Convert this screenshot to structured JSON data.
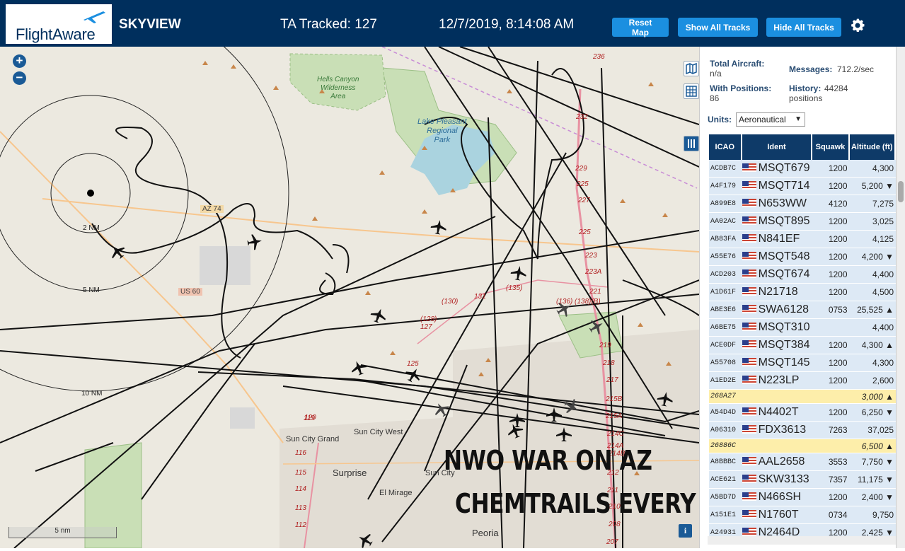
{
  "header": {
    "logo_text": "FlightAware",
    "title": "SKYVIEW",
    "tracked": "TA Tracked: 127",
    "datetime": "12/7/2019, 8:14:08 AM",
    "buttons": {
      "reset": "Reset Map",
      "show": "Show All Tracks",
      "hide": "Hide All Tracks"
    },
    "colors": {
      "bar": "#002f5d",
      "button": "#1b8fe0"
    }
  },
  "map": {
    "zoom_in": "+",
    "zoom_out": "−",
    "scale": "5 nm",
    "info": "i",
    "range_labels": [
      "2 NM",
      "5 NM",
      "10 NM"
    ],
    "place_labels": {
      "wilderness": [
        "Hells Canyon",
        "Wilderness",
        "Area"
      ],
      "lake": [
        "Lake Pleasant",
        "Regional",
        "Park"
      ],
      "sun_city_grand": "Sun City Grand",
      "sun_city_west": "Sun City West",
      "surprise": "Surprise",
      "sun_city": "Sun City",
      "el_mirage": "El Mirage",
      "peoria": "Peoria"
    },
    "road_labels": {
      "az74": "AZ 74",
      "us60": "US 60",
      "r130": "(130)",
      "r131": "131",
      "r135": "(135)",
      "r128": "(128)",
      "r127": "127",
      "r125": "125",
      "r136": "(136)",
      "r138b": "(138)(B)"
    },
    "exit_numbers_east": [
      "236",
      "232",
      "229",
      "225",
      "227",
      "225",
      "223",
      "223A",
      "221",
      "219",
      "218",
      "217",
      "215B",
      "215A",
      "214C",
      "214A",
      "214B",
      "212",
      "211",
      "210",
      "208",
      "207"
    ],
    "exit_numbers_west": [
      "119",
      "116",
      "115",
      "114",
      "113",
      "112",
      "120"
    ],
    "overlay_text_1": "NWO WAR ON AZ",
    "overlay_text_2": "CHEMTRAILS EVERY DAY"
  },
  "panel": {
    "total_aircraft_label": "Total Aircraft:",
    "total_aircraft_value": "n/a",
    "messages_label": "Messages:",
    "messages_value": "712.2/sec",
    "positions_label": "With Positions:",
    "positions_value": "86",
    "history_label": "History:",
    "history_value": "44284",
    "history_unit": "positions",
    "units_label": "Units:",
    "units_value": "Aeronautical",
    "columns": [
      "ICAO",
      "Ident",
      "Squawk",
      "Altitude (ft)"
    ],
    "rows": [
      {
        "icao": "ACDB7C",
        "ident": "MSQT679",
        "squawk": "1200",
        "alt": "4,300",
        "flag": true,
        "hl": false
      },
      {
        "icao": "A4F179",
        "ident": "MSQT714",
        "squawk": "1200",
        "alt": "5,200 ▼",
        "flag": true,
        "hl": false
      },
      {
        "icao": "A899E8",
        "ident": "N653WW",
        "squawk": "4120",
        "alt": "7,275",
        "flag": true,
        "hl": false
      },
      {
        "icao": "AA02AC",
        "ident": "MSQT895",
        "squawk": "1200",
        "alt": "3,025",
        "flag": true,
        "hl": false
      },
      {
        "icao": "AB83FA",
        "ident": "N841EF",
        "squawk": "1200",
        "alt": "4,125",
        "flag": true,
        "hl": false
      },
      {
        "icao": "A55E76",
        "ident": "MSQT548",
        "squawk": "1200",
        "alt": "4,200 ▼",
        "flag": true,
        "hl": false
      },
      {
        "icao": "ACD203",
        "ident": "MSQT674",
        "squawk": "1200",
        "alt": "4,400",
        "flag": true,
        "hl": false
      },
      {
        "icao": "A1D61F",
        "ident": "N21718",
        "squawk": "1200",
        "alt": "4,500",
        "flag": true,
        "hl": false
      },
      {
        "icao": "ABE3E6",
        "ident": "SWA6128",
        "squawk": "0753",
        "alt": "25,525 ▲",
        "flag": true,
        "hl": false
      },
      {
        "icao": "A6BE75",
        "ident": "MSQT310",
        "squawk": "",
        "alt": "4,400",
        "flag": true,
        "hl": false
      },
      {
        "icao": "ACE0DF",
        "ident": "MSQT384",
        "squawk": "1200",
        "alt": "4,300 ▲",
        "flag": true,
        "hl": false
      },
      {
        "icao": "A55708",
        "ident": "MSQT145",
        "squawk": "1200",
        "alt": "4,300",
        "flag": true,
        "hl": false
      },
      {
        "icao": "A1ED2E",
        "ident": "N223LP",
        "squawk": "1200",
        "alt": "2,600",
        "flag": true,
        "hl": false
      },
      {
        "icao": "268A27",
        "ident": "",
        "squawk": "",
        "alt": "3,000 ▲",
        "flag": false,
        "hl": true
      },
      {
        "icao": "A54D4D",
        "ident": "N4402T",
        "squawk": "1200",
        "alt": "6,250 ▼",
        "flag": true,
        "hl": false
      },
      {
        "icao": "A06310",
        "ident": "FDX3613",
        "squawk": "7263",
        "alt": "37,025",
        "flag": true,
        "hl": false
      },
      {
        "icao": "26886C",
        "ident": "",
        "squawk": "",
        "alt": "6,500 ▲",
        "flag": false,
        "hl": true
      },
      {
        "icao": "A8BBBC",
        "ident": "AAL2658",
        "squawk": "3553",
        "alt": "7,750 ▼",
        "flag": true,
        "hl": false
      },
      {
        "icao": "ACE621",
        "ident": "SKW3133",
        "squawk": "7357",
        "alt": "11,175 ▼",
        "flag": true,
        "hl": false
      },
      {
        "icao": "A5BD7D",
        "ident": "N466SH",
        "squawk": "1200",
        "alt": "2,400 ▼",
        "flag": true,
        "hl": false
      },
      {
        "icao": "A151E1",
        "ident": "N1760T",
        "squawk": "0734",
        "alt": "9,750",
        "flag": true,
        "hl": false
      },
      {
        "icao": "A24931",
        "ident": "N2464D",
        "squawk": "1200",
        "alt": "2,425 ▼",
        "flag": true,
        "hl": false
      }
    ]
  }
}
